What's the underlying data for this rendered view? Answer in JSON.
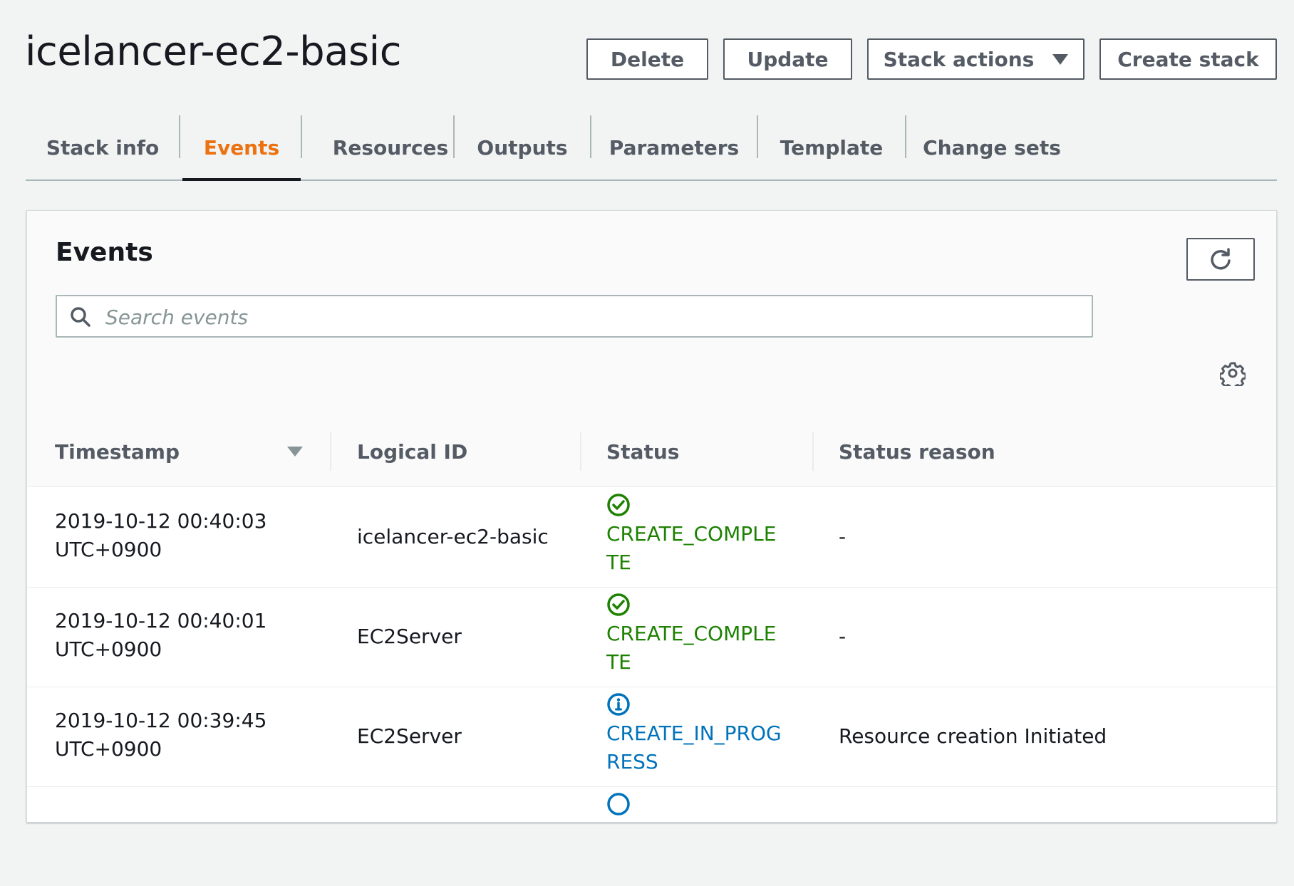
{
  "page": {
    "title": "icelancer-ec2-basic"
  },
  "actions": {
    "delete_label": "Delete",
    "update_label": "Update",
    "stack_actions_label": "Stack actions",
    "create_stack_label": "Create stack"
  },
  "tabs": [
    {
      "label": "Stack info",
      "active": false
    },
    {
      "label": "Events",
      "active": true
    },
    {
      "label": "Resources",
      "active": false
    },
    {
      "label": "Outputs",
      "active": false
    },
    {
      "label": "Parameters",
      "active": false
    },
    {
      "label": "Template",
      "active": false
    },
    {
      "label": "Change sets",
      "active": false
    }
  ],
  "events": {
    "title": "Events",
    "search_placeholder": "Search events",
    "search_value": "",
    "columns": {
      "timestamp": "Timestamp",
      "logical_id": "Logical ID",
      "status": "Status",
      "status_reason": "Status reason"
    },
    "rows": [
      {
        "timestamp_date": "2019-10-12 00:40:03",
        "timestamp_tz": "UTC+0900",
        "logical_id": "icelancer-ec2-basic",
        "status": "CREATE_COMPLETE",
        "status_icon": "check-circle-icon",
        "status_reason": "-"
      },
      {
        "timestamp_date": "2019-10-12 00:40:01",
        "timestamp_tz": "UTC+0900",
        "logical_id": "EC2Server",
        "status": "CREATE_COMPLETE",
        "status_icon": "check-circle-icon",
        "status_reason": "-"
      },
      {
        "timestamp_date": "2019-10-12 00:39:45",
        "timestamp_tz": "UTC+0900",
        "logical_id": "EC2Server",
        "status": "CREATE_IN_PROGRESS",
        "status_icon": "info-circle-icon",
        "status_reason": "Resource creation Initiated"
      }
    ]
  },
  "colors": {
    "accent_active_tab": "#ec7211",
    "status_complete": "#1d8102",
    "status_in_progress": "#0073bb"
  }
}
